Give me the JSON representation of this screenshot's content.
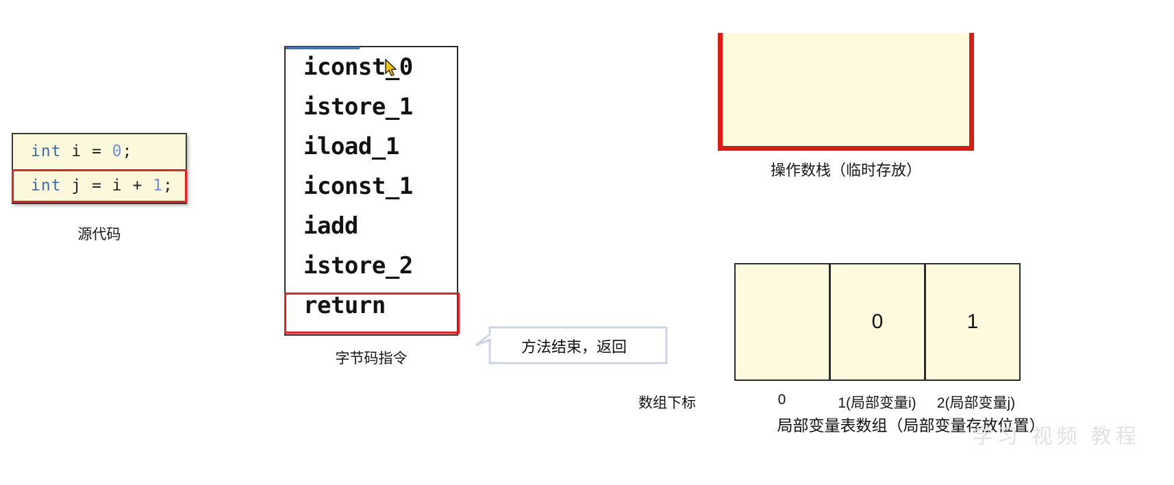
{
  "source": {
    "caption": "源代码",
    "lines": [
      {
        "kw": "int",
        "rest": " i = ",
        "num": "0",
        "tail": ";"
      },
      {
        "kw": "int",
        "rest": " j = i + ",
        "num": "1",
        "tail": ";"
      }
    ],
    "highlighted_line_index": 1,
    "highlight_color": "#ee1c1c",
    "bg_color": "#fbf8dc",
    "keyword_color": "#3a6ea5",
    "number_color": "#6b93d6"
  },
  "bytecode": {
    "caption": "字节码指令",
    "instructions": [
      "iconst_0",
      "istore_1",
      "iload_1",
      "iconst_1",
      "iadd",
      "istore_2",
      "return"
    ],
    "highlighted_instruction": "return",
    "highlight_color": "#ee1c1c",
    "progress_bar_color": "#3e72b8"
  },
  "callout": {
    "text": "方法结束，返回",
    "border_color": "#ccd4e4"
  },
  "operand_stack": {
    "caption": "操作数栈（临时存放）",
    "items": [],
    "border_color": "#dc1c13",
    "fill_color": "#fdfade"
  },
  "local_variable_table": {
    "caption": "局部变量表数组（局部变量存放位置）",
    "index_label": "数组下标",
    "cells": [
      {
        "value": "",
        "index_label": "0"
      },
      {
        "value": "0",
        "index_label": "1(局部变量i)"
      },
      {
        "value": "1",
        "index_label": "2(局部变量j)"
      }
    ],
    "fill_color": "#fdfade",
    "border_color": "#2b2b2b"
  },
  "cursor": {
    "icon": "arrow-pointer"
  },
  "watermark": {
    "text": "学习 视频 教程"
  }
}
